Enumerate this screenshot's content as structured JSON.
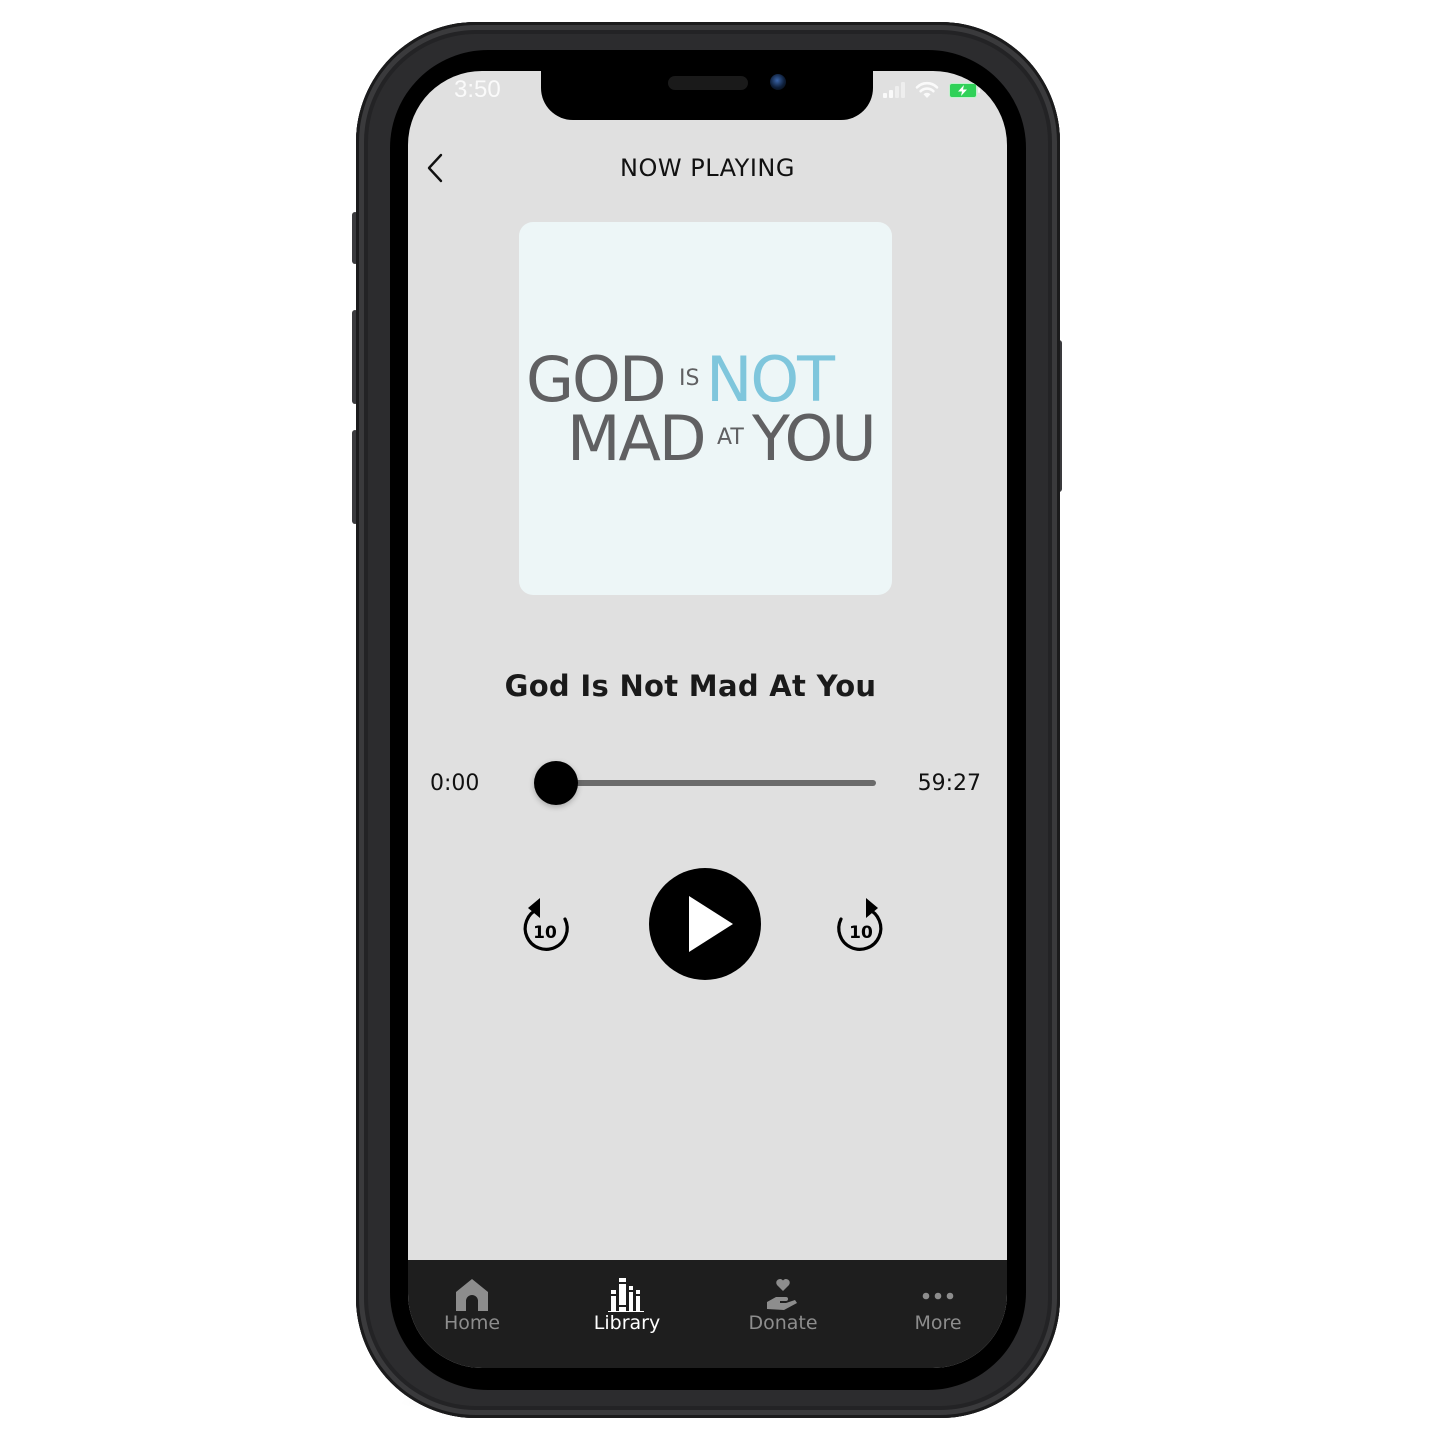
{
  "status_bar": {
    "time": "3:50",
    "signal_icon": "cellular-signal-icon",
    "wifi_icon": "wifi-icon",
    "battery_icon": "battery-charging-icon",
    "battery_color": "#30d158"
  },
  "header": {
    "back_icon": "chevron-left-icon",
    "title": "NOW PLAYING"
  },
  "artwork": {
    "line1": {
      "word1": "GOD",
      "small1": "IS",
      "word2": "NOT"
    },
    "line2": {
      "word1": "MAD",
      "small1": "AT",
      "word2": "YOU"
    },
    "text_color": "#606062",
    "accent_color": "#7fc6dc",
    "background_color": "#edf6f7"
  },
  "player": {
    "track_title": "God Is Not Mad At You",
    "elapsed": "0:00",
    "duration": "59:27",
    "progress_fraction": 0.0,
    "rewind_seconds": "10",
    "forward_seconds": "10",
    "rewind_icon": "rewind-10-icon",
    "play_icon": "play-icon",
    "forward_icon": "forward-10-icon"
  },
  "tab_bar": {
    "active": "Library",
    "tabs": [
      {
        "label": "Home",
        "icon": "home-icon"
      },
      {
        "label": "Library",
        "icon": "library-icon"
      },
      {
        "label": "Donate",
        "icon": "donate-icon"
      },
      {
        "label": "More",
        "icon": "more-icon"
      }
    ]
  }
}
